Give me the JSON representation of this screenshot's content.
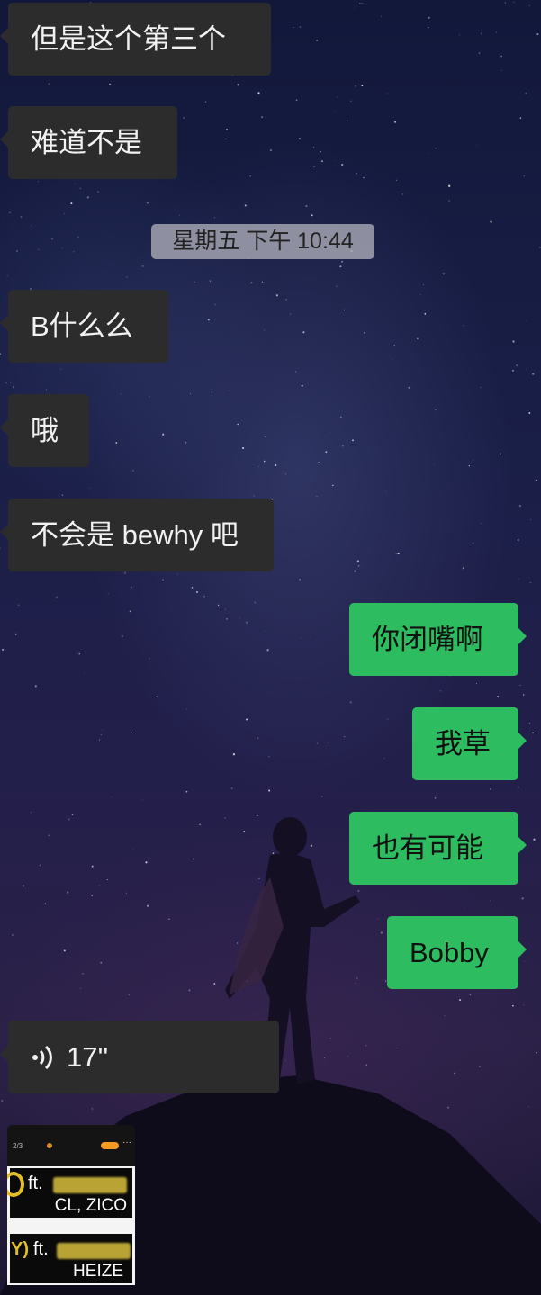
{
  "chat": {
    "messages": [
      {
        "side": "in",
        "text": "但是这个第三个"
      },
      {
        "side": "in",
        "text": "难道不是"
      },
      {
        "side": "in",
        "text": "B什么么"
      },
      {
        "side": "in",
        "text": "哦"
      },
      {
        "side": "in",
        "text": "不会是 bewhy 吧"
      },
      {
        "side": "out",
        "text": "你闭嘴啊"
      },
      {
        "side": "out",
        "text": "我草"
      },
      {
        "side": "out",
        "text": "也有可能"
      },
      {
        "side": "out",
        "text": "Bobby"
      }
    ],
    "timestamp": "星期五 下午 10:44",
    "voice": {
      "duration": "17''",
      "icon": "voice-wave-icon"
    },
    "image": {
      "page": "2/3",
      "card1": {
        "ft": "ft.",
        "names": "CL, ZICO"
      },
      "card2": {
        "ft": "ft.",
        "paren": "Y)",
        "names": "HEIZE"
      }
    }
  },
  "colors": {
    "incoming_bubble": "#2c2c2c",
    "outgoing_bubble": "#2dbd60",
    "timestamp_bg": "#b4b4be"
  }
}
